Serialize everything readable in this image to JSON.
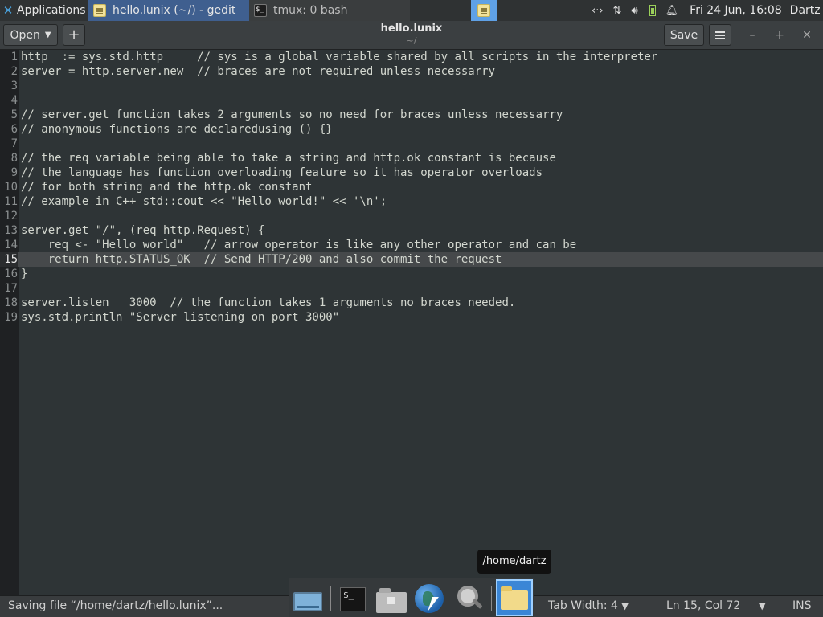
{
  "top_panel": {
    "applications_label": "Applications",
    "task_gedit": "hello.lunix (~/) - gedit",
    "task_terminal": "tmux: 0 bash",
    "clock": "Fri 24 Jun, 16:08",
    "user": "Dartz"
  },
  "header": {
    "open_label": "Open",
    "new_label": "+",
    "title": "hello.lunix",
    "subtitle": "~/",
    "save_label": "Save"
  },
  "editor": {
    "current_line": 15,
    "lines": [
      "http  := sys.std.http     // sys is a global variable shared by all scripts in the interpreter",
      "server = http.server.new  // braces are not required unless necessarry",
      "",
      "",
      "// server.get function takes 2 arguments so no need for braces unless necessarry",
      "// anonymous functions are declaredusing () {}",
      "",
      "// the req variable being able to take a string and http.ok constant is because",
      "// the language has function overloading feature so it has operator overloads",
      "// for both string and the http.ok constant",
      "// example in C++ std::cout << \"Hello world!\" << '\\n';",
      "",
      "server.get \"/\", (req http.Request) {",
      "    req <- \"Hello world\"   // arrow operator is like any other operator and can be",
      "    return http.STATUS_OK  // Send HTTP/200 and also commit the request",
      "}",
      "",
      "server.listen   3000  // the function takes 1 arguments no braces needed.",
      "sys.std.println \"Server listening on port 3000\""
    ]
  },
  "status": {
    "message": "Saving file “/home/dartz/hello.lunix”...",
    "tab_width": "Tab Width: 4",
    "position": "Ln 15, Col 72",
    "mode": "INS"
  },
  "dock": {
    "tooltip": "/home/dartz",
    "items": [
      "desktop-icon",
      "terminal-icon",
      "file-manager-icon",
      "web-browser-icon",
      "search-icon",
      "home-folder-icon"
    ]
  }
}
